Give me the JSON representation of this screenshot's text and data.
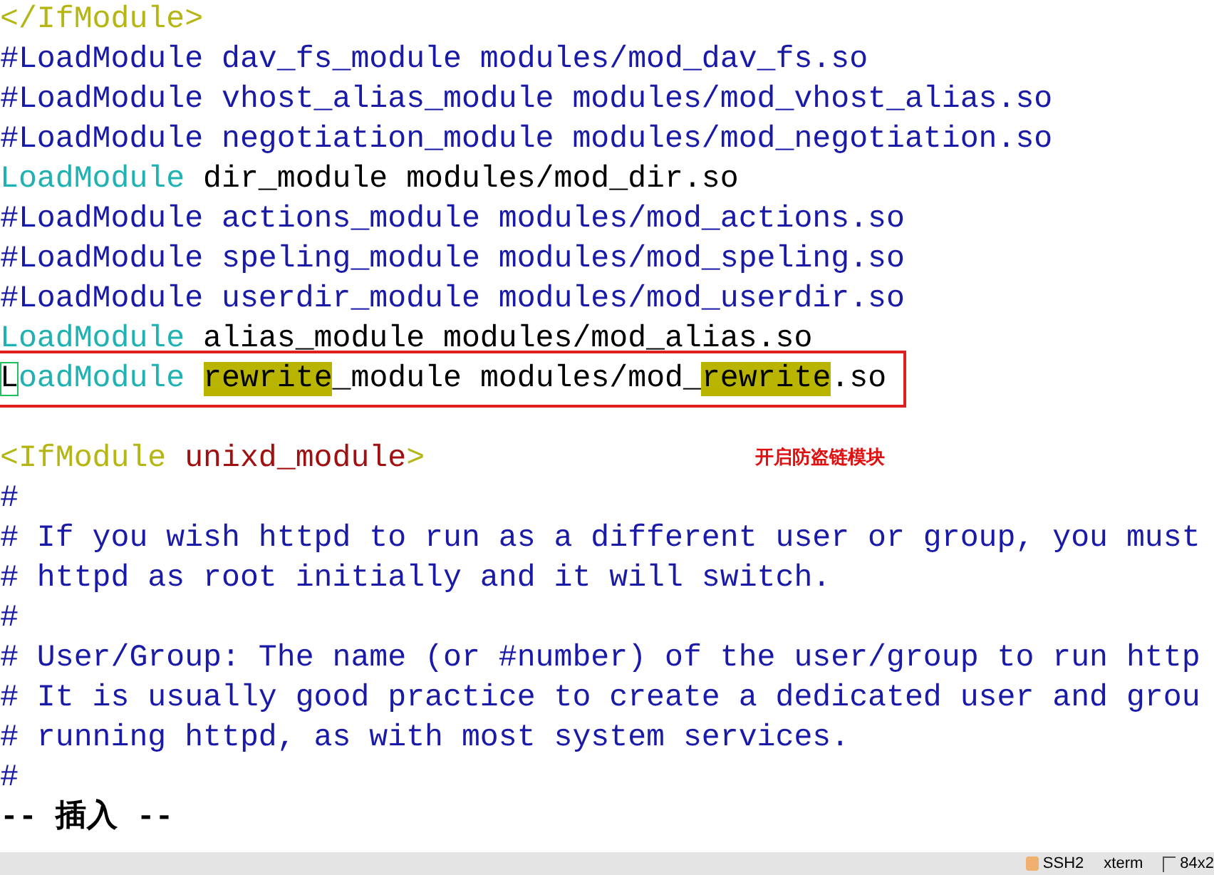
{
  "editor": {
    "lines": [
      {
        "segments": [
          {
            "kind": "tag",
            "text": "</IfModule>"
          }
        ]
      },
      {
        "segments": [
          {
            "kind": "comment",
            "text": "#LoadModule dav_fs_module modules/mod_dav_fs.so"
          }
        ]
      },
      {
        "segments": [
          {
            "kind": "comment",
            "text": "#LoadModule vhost_alias_module modules/mod_vhost_alias.so"
          }
        ]
      },
      {
        "segments": [
          {
            "kind": "comment",
            "text": "#LoadModule negotiation_module modules/mod_negotiation.so"
          }
        ]
      },
      {
        "segments": [
          {
            "kind": "keyword",
            "text": "LoadModule"
          },
          {
            "kind": "text",
            "text": " dir_module modules/mod_dir.so"
          }
        ]
      },
      {
        "segments": [
          {
            "kind": "comment",
            "text": "#LoadModule actions_module modules/mod_actions.so"
          }
        ]
      },
      {
        "segments": [
          {
            "kind": "comment",
            "text": "#LoadModule speling_module modules/mod_speling.so"
          }
        ]
      },
      {
        "segments": [
          {
            "kind": "comment",
            "text": "#LoadModule userdir_module modules/mod_userdir.so"
          }
        ]
      },
      {
        "segments": [
          {
            "kind": "keyword",
            "text": "LoadModule"
          },
          {
            "kind": "text",
            "text": " alias_module modules/mod_alias.so"
          }
        ]
      },
      {
        "boxed": true,
        "segments": [
          {
            "kind": "cursor",
            "text": "L"
          },
          {
            "kind": "keyword",
            "text": "oadModule "
          },
          {
            "kind": "match",
            "text": "rewrite"
          },
          {
            "kind": "text",
            "text": "_module modules/mod_"
          },
          {
            "kind": "match",
            "text": "rewrite"
          },
          {
            "kind": "text",
            "text": ".so"
          }
        ]
      },
      {
        "kind": "blank"
      },
      {
        "note": "开启防盗链模块",
        "segments": [
          {
            "kind": "tag",
            "text": "<IfModule "
          },
          {
            "kind": "tag-arg",
            "text": "unixd_module"
          },
          {
            "kind": "tag",
            "text": ">"
          }
        ]
      },
      {
        "segments": [
          {
            "kind": "comment",
            "text": "#"
          }
        ]
      },
      {
        "segments": [
          {
            "kind": "comment",
            "text": "# If you wish httpd to run as a different user or group, you must"
          }
        ]
      },
      {
        "segments": [
          {
            "kind": "comment",
            "text": "# httpd as root initially and it will switch."
          }
        ]
      },
      {
        "segments": [
          {
            "kind": "comment",
            "text": "#"
          }
        ]
      },
      {
        "segments": [
          {
            "kind": "comment",
            "text": "# User/Group: The name (or #number) of the user/group to run http"
          }
        ]
      },
      {
        "segments": [
          {
            "kind": "comment",
            "text": "# It is usually good practice to create a dedicated user and grou"
          }
        ]
      },
      {
        "segments": [
          {
            "kind": "comment",
            "text": "# running httpd, as with most system services."
          }
        ]
      },
      {
        "segments": [
          {
            "kind": "comment",
            "text": "#"
          }
        ]
      },
      {
        "segments": [
          {
            "kind": "mode",
            "text": "-- 插入 --"
          }
        ]
      }
    ]
  },
  "status_bar": {
    "items": [
      "SSH2",
      "xterm",
      "84x2"
    ]
  }
}
